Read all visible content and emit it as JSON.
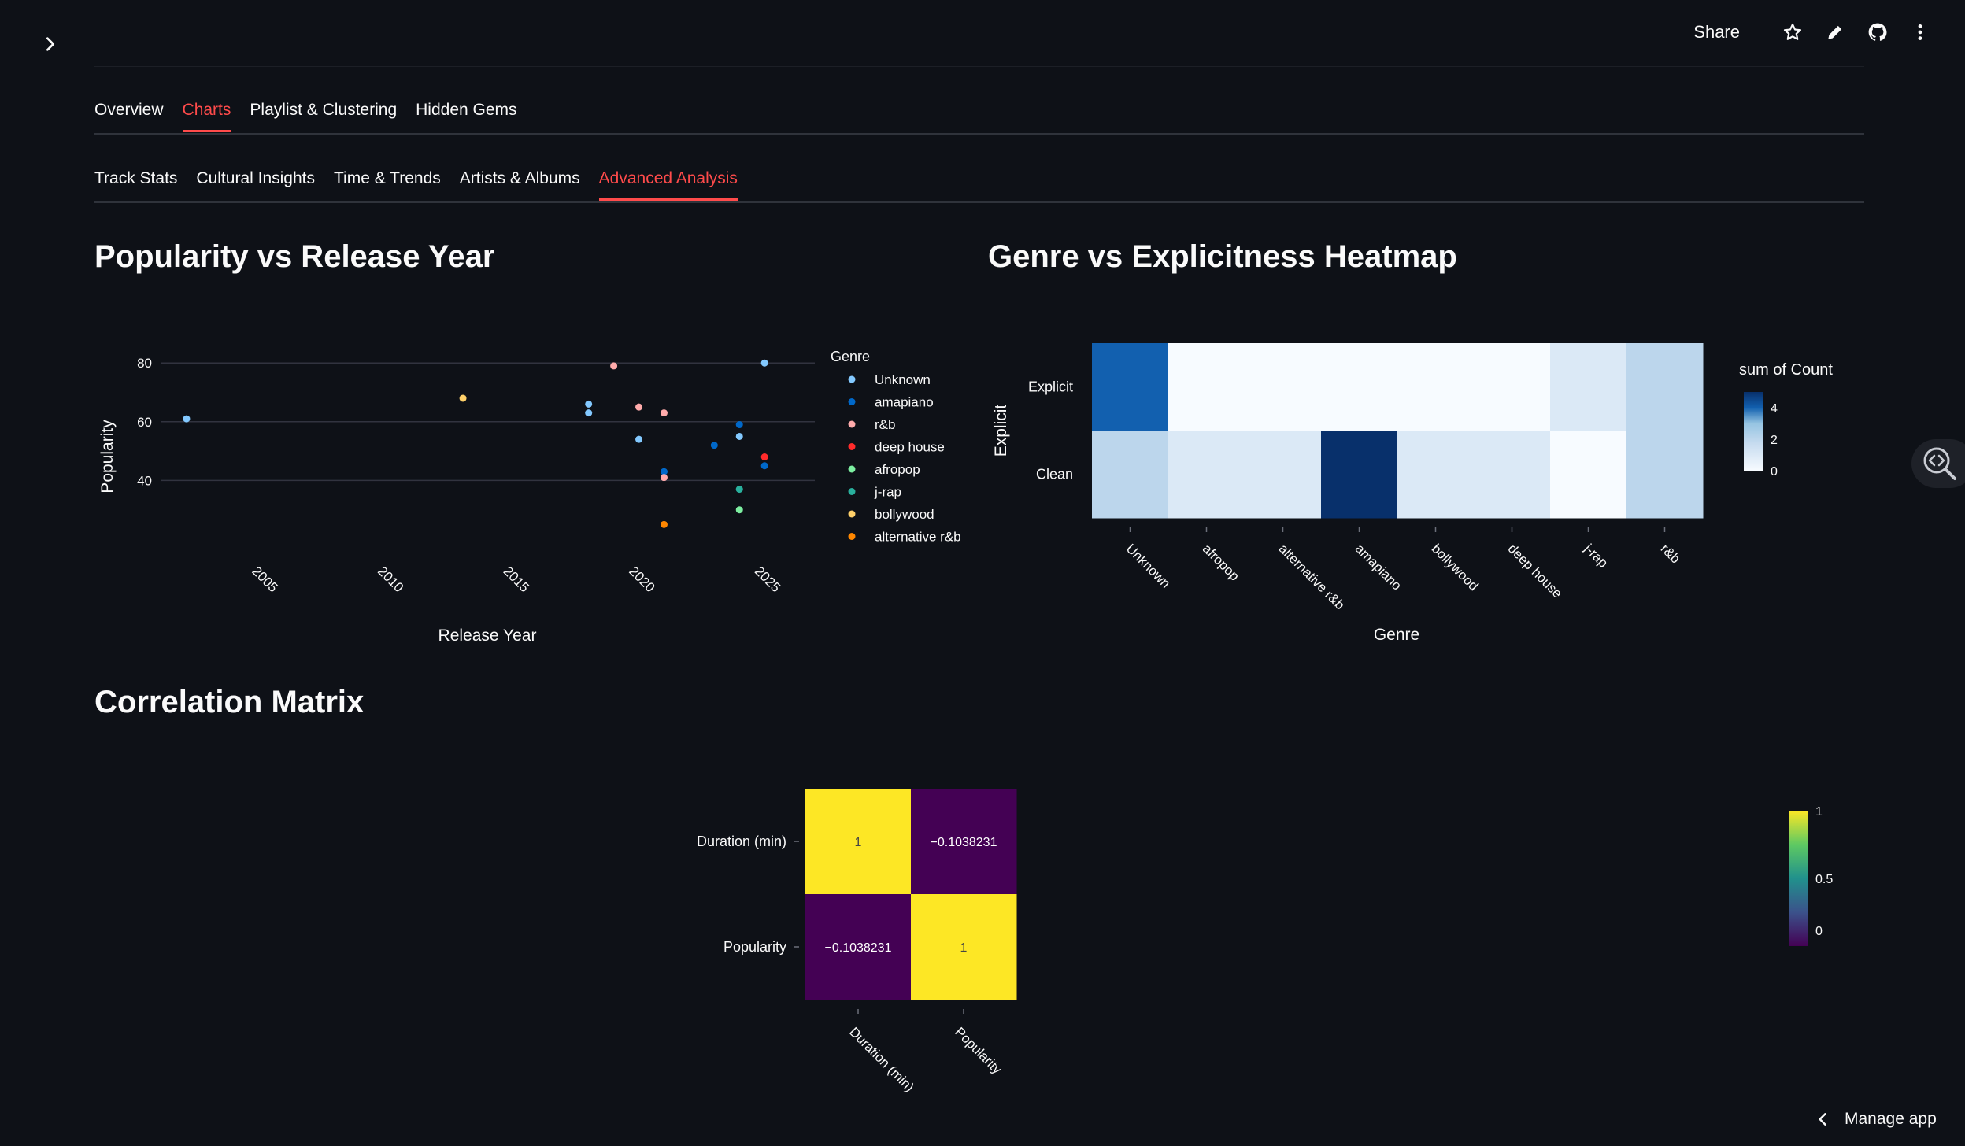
{
  "header": {
    "share_label": "Share",
    "icons": [
      "chevron-right-icon",
      "star-icon",
      "pencil-icon",
      "github-icon",
      "more-vertical-icon"
    ]
  },
  "main_tabs": [
    {
      "label": "Overview",
      "active": false
    },
    {
      "label": "Charts",
      "active": true
    },
    {
      "label": "Playlist & Clustering",
      "active": false
    },
    {
      "label": "Hidden Gems",
      "active": false
    }
  ],
  "sub_tabs": [
    {
      "label": "Track Stats",
      "active": false
    },
    {
      "label": "Cultural Insights",
      "active": false
    },
    {
      "label": "Time & Trends",
      "active": false
    },
    {
      "label": "Artists & Albums",
      "active": false
    },
    {
      "label": "Advanced Analysis",
      "active": true
    }
  ],
  "sections": {
    "scatter_title": "Popularity vs Release Year",
    "heatmap_title": "Genre vs Explicitness Heatmap",
    "corr_title": "Correlation Matrix"
  },
  "footer": {
    "manage_label": "Manage app"
  },
  "colors": {
    "accent": "#ff4b4b",
    "background": "#0e1117"
  },
  "chart_data": [
    {
      "type": "scatter",
      "xlabel": "Release Year",
      "ylabel": "Popularity",
      "legend_title": "Genre",
      "xlim": [
        2001,
        2027
      ],
      "ylim": [
        20,
        83
      ],
      "x_ticks": [
        2005,
        2010,
        2015,
        2020,
        2025
      ],
      "y_ticks": [
        40,
        60,
        80
      ],
      "series": [
        {
          "name": "Unknown",
          "color": "#83c9ff",
          "points": [
            [
              2002,
              61
            ],
            [
              2018,
              66
            ],
            [
              2018,
              63
            ],
            [
              2020,
              54
            ],
            [
              2024,
              55
            ],
            [
              2025,
              80
            ]
          ]
        },
        {
          "name": "amapiano",
          "color": "#0068c9",
          "points": [
            [
              2021,
              43
            ],
            [
              2023,
              52
            ],
            [
              2024,
              59
            ],
            [
              2025,
              45
            ]
          ]
        },
        {
          "name": "r&b",
          "color": "#ffabab",
          "points": [
            [
              2019,
              79
            ],
            [
              2020,
              65
            ],
            [
              2021,
              63
            ],
            [
              2021,
              41
            ]
          ]
        },
        {
          "name": "deep house",
          "color": "#ff2b2b",
          "points": [
            [
              2025,
              48
            ]
          ]
        },
        {
          "name": "afropop",
          "color": "#7defa1",
          "points": [
            [
              2024,
              30
            ]
          ]
        },
        {
          "name": "j-rap",
          "color": "#29b09d",
          "points": [
            [
              2024,
              37
            ]
          ]
        },
        {
          "name": "bollywood",
          "color": "#ffd16a",
          "points": [
            [
              2013,
              68
            ]
          ]
        },
        {
          "name": "alternative r&b",
          "color": "#ff8700",
          "points": [
            [
              2021,
              25
            ]
          ]
        }
      ]
    },
    {
      "type": "heatmap",
      "xlabel": "Genre",
      "ylabel": "Explicit",
      "colorbar_title": "sum of Count",
      "colorbar_ticks": [
        0,
        2,
        4
      ],
      "zmax": 5,
      "x": [
        "Unknown",
        "afropop",
        "alternative r&b",
        "amapiano",
        "bollywood",
        "deep house",
        "j-rap",
        "r&b"
      ],
      "y": [
        "Explicit",
        "Clean"
      ],
      "z": [
        [
          4,
          0,
          0,
          0,
          0,
          0,
          1,
          2
        ],
        [
          2,
          1,
          1,
          5,
          1,
          1,
          0,
          2
        ]
      ]
    },
    {
      "type": "heatmap",
      "x": [
        "Duration (min)",
        "Popularity"
      ],
      "y": [
        "Duration (min)",
        "Popularity"
      ],
      "z": [
        [
          1,
          -0.1038231
        ],
        [
          -0.1038231,
          1
        ]
      ],
      "text": [
        [
          "1",
          "−0.1038231"
        ],
        [
          "−0.1038231",
          "1"
        ]
      ],
      "colorbar_ticks": [
        "1",
        "0.5",
        "0"
      ],
      "colorscale": "viridis"
    }
  ]
}
